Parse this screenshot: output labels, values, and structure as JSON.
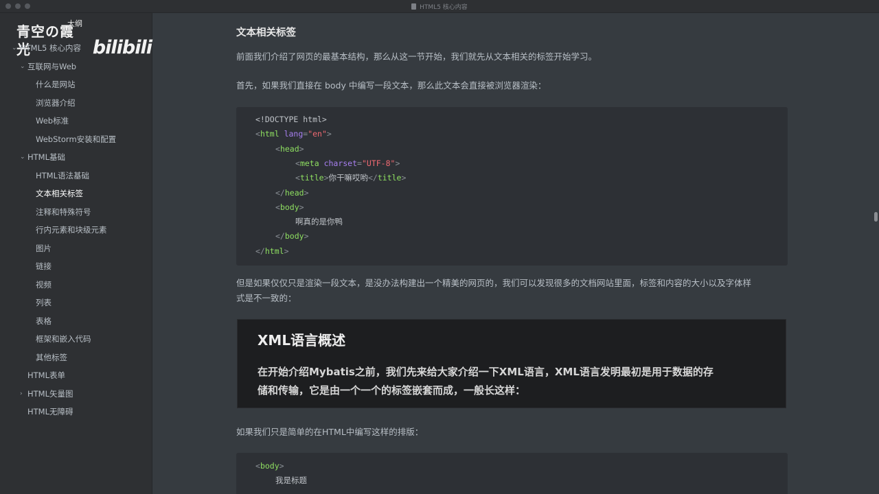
{
  "window": {
    "title": "HTML5 核心内容"
  },
  "watermark": {
    "name": "青空の霞光",
    "logo": "bilibili"
  },
  "sidebar": {
    "outline_label": "大纲",
    "items": [
      {
        "label": "HTML5 核心内容",
        "level": 0,
        "chevron": "⌄"
      },
      {
        "label": "互联网与Web",
        "level": 1,
        "chevron": "⌄"
      },
      {
        "label": "什么是网站",
        "level": 2
      },
      {
        "label": "浏览器介绍",
        "level": 2
      },
      {
        "label": "Web标准",
        "level": 2
      },
      {
        "label": "WebStorm安装和配置",
        "level": 2
      },
      {
        "label": "HTML基础",
        "level": 1,
        "chevron": "⌄"
      },
      {
        "label": "HTML语法基础",
        "level": 2
      },
      {
        "label": "文本相关标签",
        "level": 2,
        "active": true
      },
      {
        "label": "注释和特殊符号",
        "level": 2
      },
      {
        "label": "行内元素和块级元素",
        "level": 2
      },
      {
        "label": "图片",
        "level": 2
      },
      {
        "label": "链接",
        "level": 2
      },
      {
        "label": "视频",
        "level": 2
      },
      {
        "label": "列表",
        "level": 2
      },
      {
        "label": "表格",
        "level": 2
      },
      {
        "label": "框架和嵌入代码",
        "level": 2
      },
      {
        "label": "其他标签",
        "level": 2
      },
      {
        "label": "HTML表单",
        "level": 1
      },
      {
        "label": "HTML矢量图",
        "level": 1,
        "chevron": "›"
      },
      {
        "label": "HTML无障碍",
        "level": 1
      }
    ]
  },
  "content": {
    "section_title": "文本相关标签",
    "para1": "前面我们介绍了网页的最基本结构，那么从这一节开始，我们就先从文本相关的标签开始学习。",
    "para2": "首先，如果我们直接在 body 中编写一段文本，那么此文本会直接被浏览器渲染：",
    "code1": [
      {
        "indent": 0,
        "parts": [
          {
            "t": "<!DOCTYPE html>",
            "c": "plain"
          }
        ]
      },
      {
        "indent": 0,
        "parts": [
          {
            "t": "<",
            "c": "punc"
          },
          {
            "t": "html",
            "c": "tag"
          },
          {
            "t": " lang",
            "c": "attr"
          },
          {
            "t": "=",
            "c": "punc"
          },
          {
            "t": "\"en\"",
            "c": "val"
          },
          {
            "t": ">",
            "c": "punc"
          }
        ]
      },
      {
        "indent": 1,
        "parts": [
          {
            "t": "<",
            "c": "punc"
          },
          {
            "t": "head",
            "c": "tag"
          },
          {
            "t": ">",
            "c": "punc"
          }
        ]
      },
      {
        "indent": 2,
        "parts": [
          {
            "t": "<",
            "c": "punc"
          },
          {
            "t": "meta",
            "c": "tag"
          },
          {
            "t": " charset",
            "c": "attr"
          },
          {
            "t": "=",
            "c": "punc"
          },
          {
            "t": "\"UTF-8\"",
            "c": "val"
          },
          {
            "t": ">",
            "c": "punc"
          }
        ]
      },
      {
        "indent": 2,
        "parts": [
          {
            "t": "<",
            "c": "punc"
          },
          {
            "t": "title",
            "c": "tag"
          },
          {
            "t": ">",
            "c": "punc"
          },
          {
            "t": "你干嘛哎哟",
            "c": "plain"
          },
          {
            "t": "</",
            "c": "punc"
          },
          {
            "t": "title",
            "c": "tag"
          },
          {
            "t": ">",
            "c": "punc"
          }
        ]
      },
      {
        "indent": 1,
        "parts": [
          {
            "t": "</",
            "c": "punc"
          },
          {
            "t": "head",
            "c": "tag"
          },
          {
            "t": ">",
            "c": "punc"
          }
        ]
      },
      {
        "indent": 1,
        "parts": [
          {
            "t": "<",
            "c": "punc"
          },
          {
            "t": "body",
            "c": "tag"
          },
          {
            "t": ">",
            "c": "punc"
          }
        ]
      },
      {
        "indent": 2,
        "parts": [
          {
            "t": "啊真的是你鸭",
            "c": "plain"
          }
        ]
      },
      {
        "indent": 1,
        "parts": [
          {
            "t": "</",
            "c": "punc"
          },
          {
            "t": "body",
            "c": "tag"
          },
          {
            "t": ">",
            "c": "punc"
          }
        ]
      },
      {
        "indent": 0,
        "parts": [
          {
            "t": "</",
            "c": "punc"
          },
          {
            "t": "html",
            "c": "tag"
          },
          {
            "t": ">",
            "c": "punc"
          }
        ]
      }
    ],
    "para3_line1": "但是如果仅仅只是渲染一段文本，是没办法构建出一个精美的网页的，我们可以发现很多的文档网站里面，标签和内容的大小以及字体样",
    "para3_line2": "式是不一致的：",
    "xml_image": {
      "title": "XML语言概述",
      "text_line1": "在开始介绍Mybatis之前，我们先来给大家介绍一下XML语言，XML语言发明最初是用于数据的存",
      "text_line2": "储和传输，它是由一个一个的标签嵌套而成，一般长这样："
    },
    "para4": "如果我们只是简单的在HTML中编写这样的排版：",
    "code2": [
      {
        "indent": 0,
        "parts": [
          {
            "t": "<",
            "c": "punc"
          },
          {
            "t": "body",
            "c": "tag"
          },
          {
            "t": ">",
            "c": "punc"
          }
        ]
      },
      {
        "indent": 1,
        "parts": [
          {
            "t": "我是标题",
            "c": "plain"
          }
        ]
      }
    ]
  }
}
